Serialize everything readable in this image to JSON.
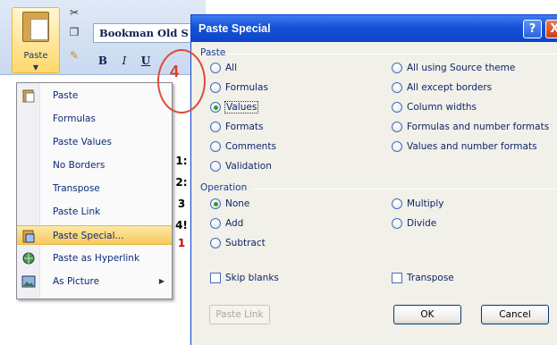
{
  "ribbon": {
    "paste_label": "Paste",
    "font_name": "Bookman Old S",
    "format_buttons": [
      "B",
      "I",
      "U"
    ]
  },
  "context_menu": {
    "items": [
      {
        "label": "Paste",
        "icon": "clipboard-paste-icon"
      },
      {
        "label": "Formulas"
      },
      {
        "label": "Paste Values"
      },
      {
        "label": "No Borders"
      },
      {
        "label": "Transpose"
      },
      {
        "label": "Paste Link"
      },
      {
        "label": "Paste Special...",
        "icon": "paste-special-icon",
        "selected": true
      },
      {
        "label": "Paste as Hyperlink",
        "icon": "hyperlink-paste-icon"
      },
      {
        "label": "As Picture",
        "icon": "picture-icon",
        "has_submenu": true
      }
    ]
  },
  "sheet_fragments": [
    "1:",
    "2:",
    "3",
    "4!",
    "1"
  ],
  "callout": {
    "number": "4",
    "color": "#e04a3c"
  },
  "dialog": {
    "title": "Paste Special",
    "help_label": "?",
    "close_label": "X",
    "paste_group_label": "Paste",
    "paste_options_left": [
      "All",
      "Formulas",
      "Values",
      "Formats",
      "Comments",
      "Validation"
    ],
    "paste_options_right": [
      "All using Source theme",
      "All except borders",
      "Column widths",
      "Formulas and number formats",
      "Values and number formats"
    ],
    "paste_selected": "Values",
    "operation_group_label": "Operation",
    "operation_options_left": [
      "None",
      "Add",
      "Subtract"
    ],
    "operation_options_right": [
      "Multiply",
      "Divide"
    ],
    "operation_selected": "None",
    "skip_blanks_label": "Skip blanks",
    "transpose_label": "Transpose",
    "paste_link_button": "Paste Link",
    "ok_button": "OK",
    "cancel_button": "Cancel"
  },
  "colors": {
    "title_bar": "#1551d6",
    "menu_highlight": "#f7c85b",
    "radio_selected": "#2aa12a",
    "text_blue": "#10256a"
  }
}
